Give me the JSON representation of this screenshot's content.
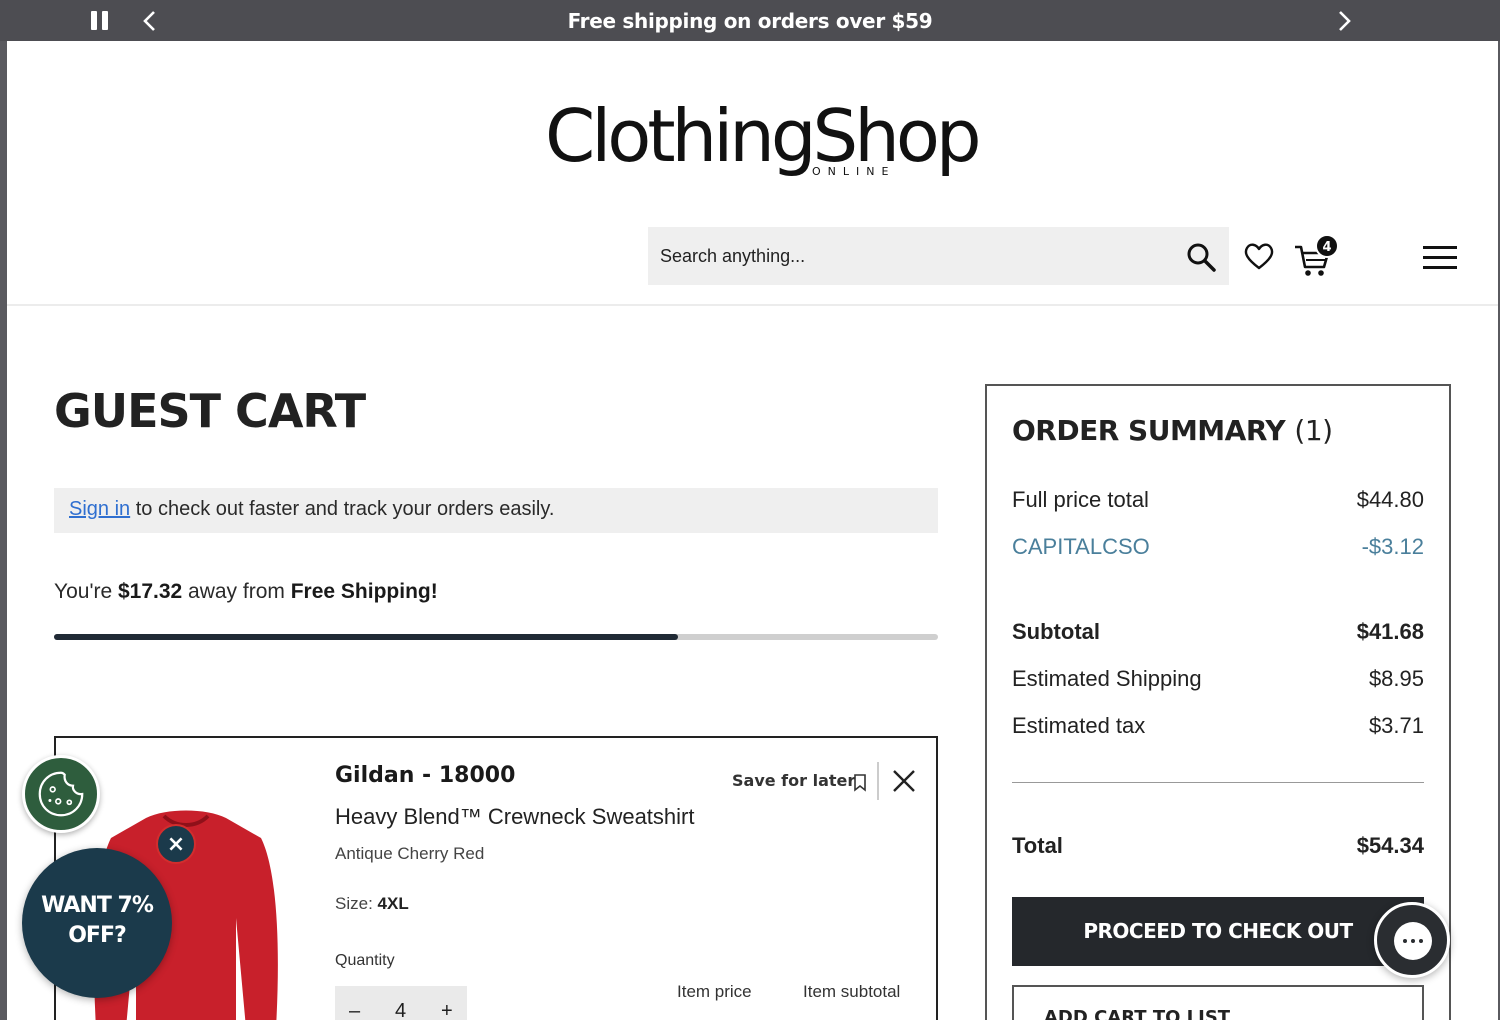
{
  "promo_bar": {
    "message": "Free shipping on orders over $59",
    "pause_icon": "pause-icon",
    "prev_icon": "chevron-left-icon",
    "next_icon": "chevron-right-icon"
  },
  "header": {
    "logo_text": "ClothingShop",
    "logo_subtext": "ONLINE",
    "search_placeholder": "Search anything...",
    "cart_count": "4",
    "icons": [
      "search-icon",
      "heart-icon",
      "cart-icon",
      "menu-icon"
    ]
  },
  "cart": {
    "title": "GUEST CART",
    "signin_link": "Sign in",
    "signin_text": " to check out faster and track your orders easily.",
    "freeship_prefix": "You're ",
    "freeship_amount": "$17.32",
    "freeship_middle": " away from ",
    "freeship_goal": "Free Shipping!",
    "freeship_progress": 0.706
  },
  "item": {
    "brand": "Gildan - 18000",
    "name": "Heavy Blend™ Crewneck Sweatshirt",
    "color": "Antique Cherry Red",
    "size_label": "Size: ",
    "size_value": "4XL",
    "quantity_label": "Quantity",
    "quantity": "4",
    "minus": "–",
    "plus": "+",
    "save_for_later": "Save for later",
    "item_price_label": "Item price",
    "item_subtotal_label": "Item subtotal",
    "product_color_hex": "#c8202b"
  },
  "summary": {
    "title": "ORDER SUMMARY",
    "count": "(1)",
    "full_price_label": "Full price total",
    "full_price_value": "$44.80",
    "promo_code": "CAPITALCSO",
    "promo_value": "-$3.12",
    "subtotal_label": "Subtotal",
    "subtotal_value": "$41.68",
    "shipping_label": "Estimated Shipping",
    "shipping_value": "$8.95",
    "tax_label": "Estimated tax",
    "tax_value": "$3.71",
    "total_label": "Total",
    "total_value": "$54.34",
    "checkout_button": "PROCEED TO CHECK OUT",
    "add_to_list_button": "ADD CART TO LIST"
  },
  "widgets": {
    "discount_line1": "WANT 7%",
    "discount_line2": "OFF?",
    "close": "×",
    "cookie_icon": "cookie-icon",
    "chat_icon": "chat-icon"
  },
  "colors": {
    "promo_bar": "#4d4d52",
    "accent_dark": "#25282c",
    "link": "#2f6fd0",
    "promo_code": "#4a7f9b",
    "cookie_bg": "#2e5d3d",
    "discount_bg": "#1b3a4b"
  }
}
